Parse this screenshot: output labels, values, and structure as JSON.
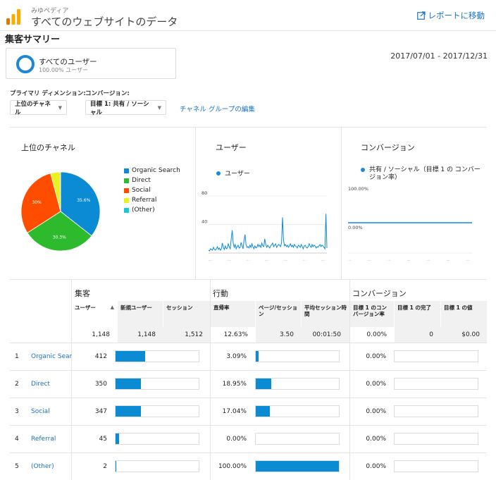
{
  "header": {
    "site_name": "みゆペディア",
    "view_name": "すべてのウェブサイトのデータ",
    "report_link": "レポートに移動"
  },
  "page_title": "集客サマリー",
  "segment": {
    "name": "すべてのユーザー",
    "percent": "100.00% ユーザー"
  },
  "date_range": "2017/07/01 - 2017/12/31",
  "controls": {
    "primary_dimension_label": "プライマリ ディメンション:",
    "conversion_label": "コンバージョン:",
    "primary_dimension_value": "上位のチャネル",
    "conversion_value": "目標 1: 共有 / ソーシャル",
    "edit_channel_link": "チャネル グループの編集"
  },
  "panels": {
    "pie_title": "上位のチャネル",
    "users_title": "ユーザー",
    "users_legend": "ユーザー",
    "conversion_title": "コンバージョン",
    "conversion_legend": "共有 / ソーシャル（目標 1 の コンバージョン率）"
  },
  "pie": {
    "slices": [
      {
        "name": "Organic Search",
        "percent": 35.6,
        "label": "35.6%",
        "color": "#0b8bd3"
      },
      {
        "name": "Direct",
        "percent": 30.3,
        "label": "30.3%",
        "color": "#2dbb2d"
      },
      {
        "name": "Social",
        "percent": 30.0,
        "label": "30%",
        "color": "#ff4d00"
      },
      {
        "name": "Referral",
        "percent": 3.9,
        "label": "",
        "color": "#e9f11e"
      },
      {
        "name": "(Other)",
        "percent": 0.2,
        "label": "",
        "color": "#19c8d6"
      }
    ]
  },
  "chart_data": [
    {
      "type": "line",
      "title": "ユーザー",
      "series": [
        {
          "name": "ユーザー"
        }
      ],
      "ylim": [
        0,
        90
      ],
      "ytick_labels": [
        "80",
        "40"
      ],
      "values": [
        4,
        3,
        6,
        5,
        4,
        8,
        5,
        4,
        6,
        9,
        5,
        7,
        4,
        6,
        14,
        8,
        5,
        10,
        6,
        7,
        13,
        9,
        6,
        20,
        32,
        14,
        8,
        12,
        6,
        9,
        11,
        7,
        8,
        15,
        10,
        6,
        18,
        26,
        12,
        8,
        9,
        7,
        11,
        8,
        13,
        9,
        6,
        10,
        7,
        8,
        12,
        9,
        11,
        8,
        14,
        10,
        9,
        20,
        12,
        8,
        11,
        9,
        7,
        10,
        12,
        14,
        9,
        11,
        13,
        8,
        10,
        12,
        11,
        9,
        14,
        50,
        18,
        10,
        12,
        9,
        11,
        8,
        10,
        13,
        9,
        11,
        8,
        12,
        10,
        9,
        7,
        11,
        10,
        8,
        12,
        9,
        6,
        10,
        11,
        8,
        7,
        9,
        13,
        10,
        8,
        12,
        9,
        11,
        10,
        7,
        9,
        8,
        10,
        12,
        9,
        11,
        10,
        8,
        6,
        55,
        7
      ]
    },
    {
      "type": "line",
      "title": "コンバージョン",
      "series": [
        {
          "name": "共有 / ソーシャル（目標 1 の コンバージョン率）",
          "values": [
            0,
            0
          ]
        }
      ],
      "ylim": [
        0,
        100
      ],
      "ytick_labels": [
        "100.00%",
        "0.00%"
      ]
    }
  ],
  "table": {
    "groups": {
      "acquisition": "集客",
      "behavior": "行動",
      "conversion": "コンバージョン"
    },
    "columns": {
      "users": "ユーザー",
      "new_users": "新規ユーザー",
      "sessions": "セッション",
      "bounce_rate": "直帰率",
      "pages_per_session": "ページ/セッション",
      "avg_session_duration": "平均セッション時間",
      "goal_conv_rate": "目標 1 のコンバージョン率",
      "goal_completions": "目標 1 の完了",
      "goal_value": "目標 1 の値"
    },
    "sort_icon": "▲",
    "totals": {
      "users": "1,148",
      "new_users": "1,148",
      "sessions": "1,512",
      "bounce_rate": "12.63%",
      "pages_per_session": "3.50",
      "avg_session_duration": "00:01:50",
      "goal_conv_rate": "0.00%",
      "goal_completions": "0",
      "goal_value": "$0.00"
    },
    "rows": [
      {
        "num": "1",
        "channel": "Organic Search",
        "users": "412",
        "users_fraction": 1.0,
        "bounce_rate": "3.09%",
        "bounce_fraction": 0.031,
        "conv_rate": "0.00%"
      },
      {
        "num": "2",
        "channel": "Direct",
        "users": "350",
        "users_fraction": 0.85,
        "bounce_rate": "18.95%",
        "bounce_fraction": 0.19,
        "conv_rate": "0.00%"
      },
      {
        "num": "3",
        "channel": "Social",
        "users": "347",
        "users_fraction": 0.84,
        "bounce_rate": "17.04%",
        "bounce_fraction": 0.17,
        "conv_rate": "0.00%"
      },
      {
        "num": "4",
        "channel": "Referral",
        "users": "45",
        "users_fraction": 0.11,
        "bounce_rate": "0.00%",
        "bounce_fraction": 0.0,
        "conv_rate": "0.00%"
      },
      {
        "num": "5",
        "channel": "(Other)",
        "users": "2",
        "users_fraction": 0.005,
        "bounce_rate": "100.00%",
        "bounce_fraction": 1.0,
        "conv_rate": "0.00%"
      }
    ]
  }
}
